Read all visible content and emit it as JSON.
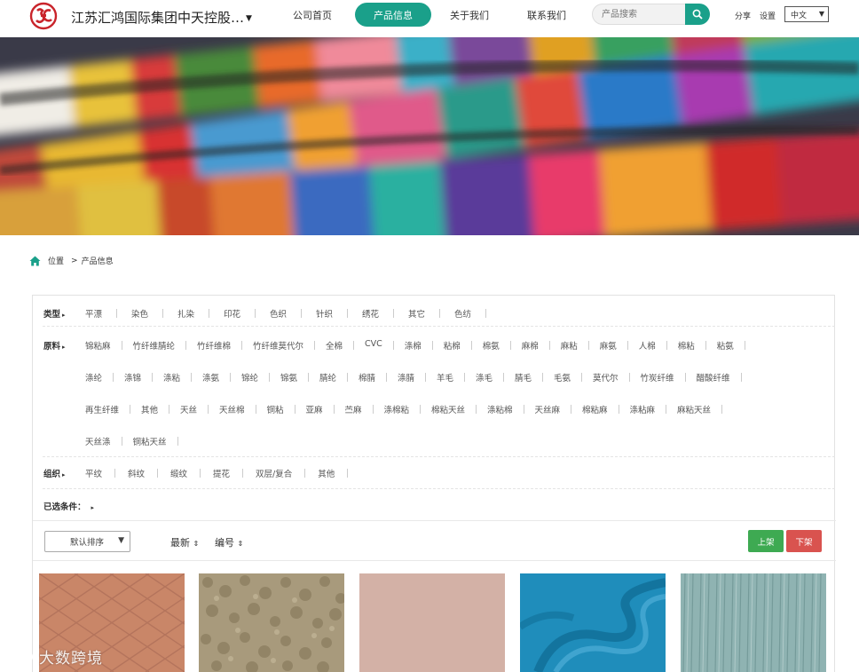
{
  "header": {
    "company_name": "江苏汇鸿国际集团中天控股…",
    "nav": [
      "公司首页",
      "产品信息",
      "关于我们",
      "联系我们"
    ],
    "active_nav": "产品信息",
    "search_placeholder": "产品搜索",
    "share_label": "分享",
    "settings_label": "设置",
    "language": "中文",
    "brand_color": "#1aa08a"
  },
  "breadcrumb": {
    "home_label": "位置",
    "separator": ">",
    "current": "产品信息"
  },
  "filters": {
    "type": {
      "label": "类型",
      "items": [
        "平漂",
        "染色",
        "扎染",
        "印花",
        "色织",
        "针织",
        "绣花",
        "其它",
        "色纺"
      ]
    },
    "material": {
      "label": "原料",
      "rows": [
        [
          "锦粘麻",
          "竹纤维腈纶",
          "竹纤维棉",
          "竹纤维莫代尔",
          "全棉",
          "CVC",
          "涤棉",
          "粘棉",
          "棉氨",
          "麻棉",
          "麻粘",
          "麻氨",
          "人棉",
          "棉粘",
          "粘氨"
        ],
        [
          "涤纶",
          "涤锦",
          "涤粘",
          "涤氨",
          "锦纶",
          "锦氨",
          "腈纶",
          "棉腈",
          "涤腈",
          "羊毛",
          "涤毛",
          "腈毛",
          "毛氨",
          "莫代尔",
          "竹炭纤维",
          "醋酸纤维"
        ],
        [
          "再生纤维",
          "其他",
          "天丝",
          "天丝棉",
          "铜粘",
          "亚麻",
          "苎麻",
          "涤棉粘",
          "棉粘天丝",
          "涤粘棉",
          "天丝麻",
          "棉粘麻",
          "涤粘麻",
          "麻粘天丝"
        ],
        [
          "天丝涤",
          "铜粘天丝"
        ]
      ]
    },
    "weave": {
      "label": "组织",
      "items": [
        "平纹",
        "斜纹",
        "缎纹",
        "提花",
        "双层/复合",
        "其他"
      ]
    },
    "selected_label": "已选条件："
  },
  "toolbar": {
    "sort_default": "默认排序",
    "sort_newest": "最新",
    "sort_code": "编号",
    "up_label": "上架",
    "down_label": "下架"
  },
  "products": [
    {
      "color": "#c98668",
      "pattern": "diamond"
    },
    {
      "color": "#a89a7c",
      "pattern": "sherpa"
    },
    {
      "color": "#d3b1a6",
      "pattern": "plain"
    },
    {
      "color": "#1f8dbb",
      "pattern": "drape"
    },
    {
      "color": "#8fb3b2",
      "pattern": "stripe"
    }
  ],
  "watermark": "大数跨境"
}
